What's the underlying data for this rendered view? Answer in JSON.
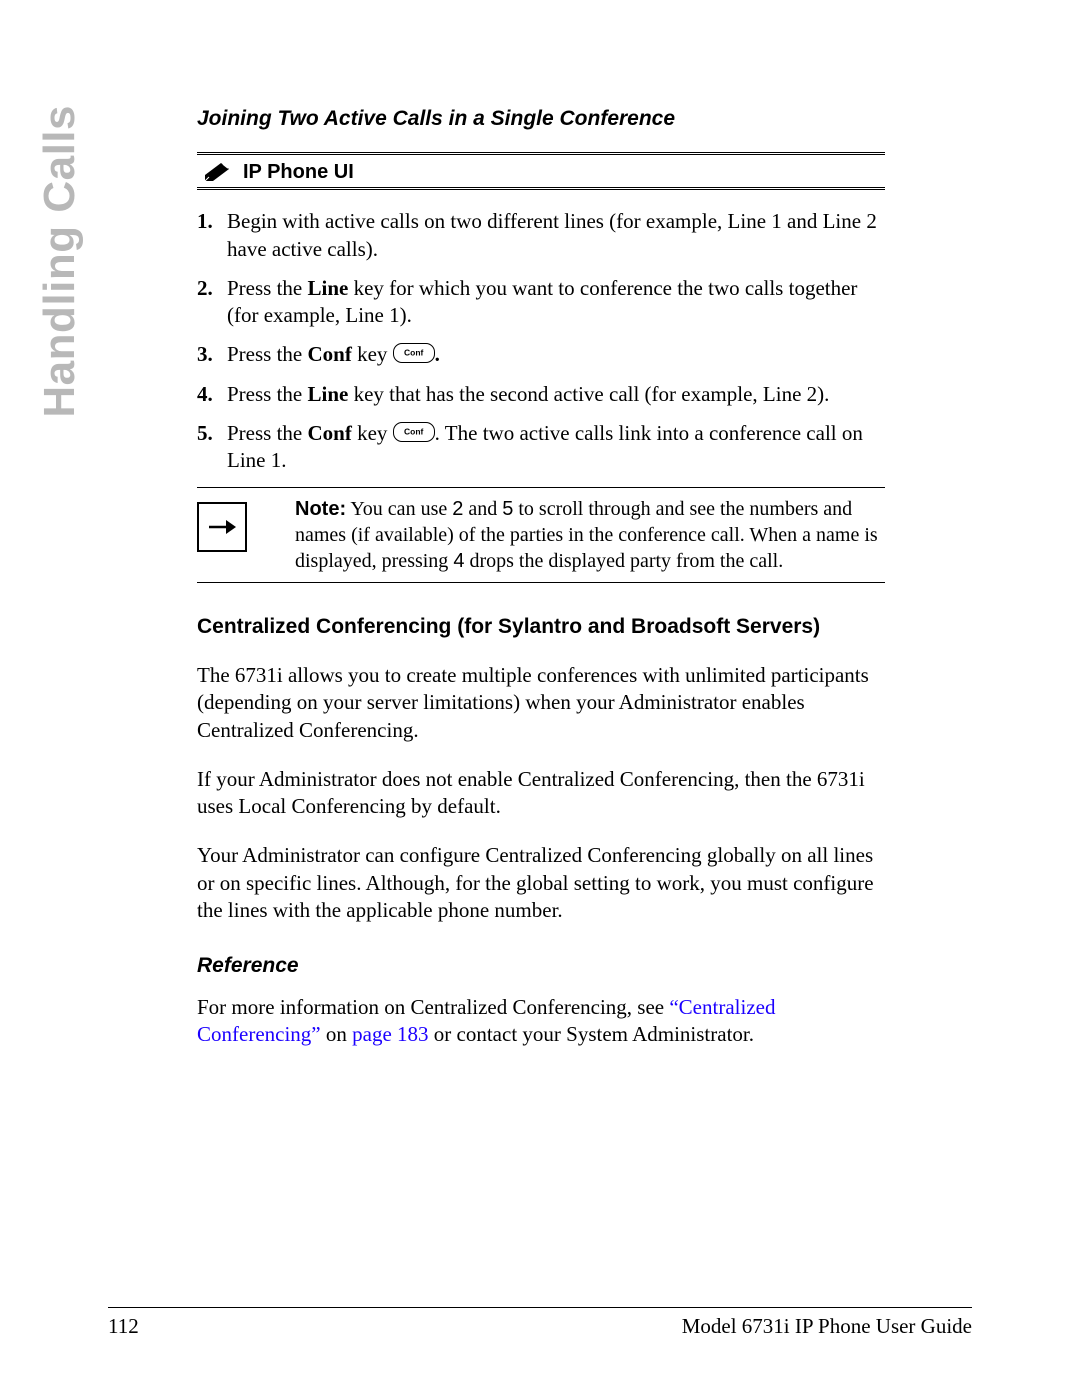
{
  "sideLabel": "Handling Calls",
  "section": {
    "title": "Joining Two Active Calls in a Single Conference",
    "banner": "IP Phone UI",
    "steps": [
      {
        "text": "Begin with active calls on two different lines (for example, Line 1 and Line 2 have active calls)."
      },
      {
        "pre": "Press the ",
        "bold": "Line",
        "post": " key for which you want to conference the two calls together (for example, Line 1)."
      },
      {
        "pre": "Press the ",
        "bold": "Conf",
        "mid": " key ",
        "hasKey": true,
        "trail": "."
      },
      {
        "pre": "Press the ",
        "bold": "Line",
        "post": " key that has the second active call (for example, Line 2)."
      },
      {
        "pre": "Press the ",
        "bold": "Conf",
        "mid": " key ",
        "hasKey": true,
        "post2": ". The two active calls link into a conference call on Line 1."
      }
    ],
    "note": {
      "label": "Note:",
      "p1a": " You can use ",
      "k2": "2",
      "p1b": " and ",
      "k5": "5",
      "p1c": " to scroll through and see the numbers and names (if available) of the parties in the conference call. When a name is displayed, pressing ",
      "k4": "4",
      "p1d": "  drops the displayed party from the call."
    }
  },
  "centralized": {
    "heading": "Centralized Conferencing (for Sylantro and Broadsoft Servers)",
    "p1": "The 6731i allows you to create multiple conferences with unlimited participants (depending on your server limitations) when your Administrator enables Centralized Conferencing.",
    "p2": "If your Administrator does not enable Centralized Conferencing, then the 6731i uses Local Conferencing by default.",
    "p3": "Your Administrator can configure Centralized Conferencing globally on all lines or on specific lines. Although, for the global setting to work, you must configure the lines with the applicable phone number."
  },
  "reference": {
    "heading": "Reference",
    "pre": "For more information on Centralized Conferencing, see ",
    "link1Text": "“Centralized Conferencing”",
    "mid": " on ",
    "link2Text": "page 183",
    "post": " or contact your System Administrator."
  },
  "footer": {
    "pageNum": "112",
    "title": "Model 6731i IP Phone User Guide"
  }
}
